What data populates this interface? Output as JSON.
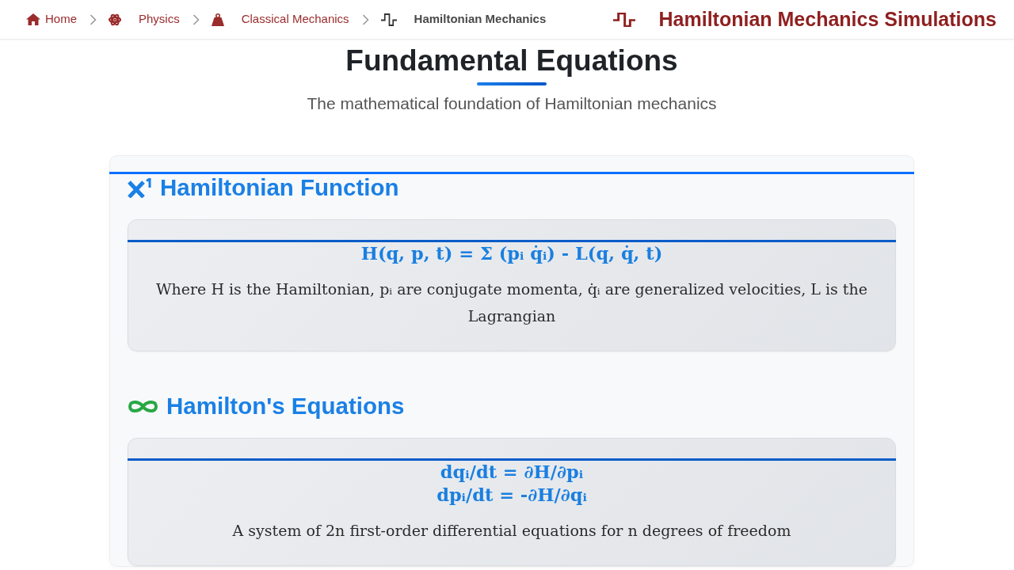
{
  "breadcrumb": [
    {
      "label": "Home",
      "current": false
    },
    {
      "label": "Physics",
      "current": false
    },
    {
      "label": "Classical Mechanics",
      "current": false
    },
    {
      "label": "Hamiltonian Mechanics",
      "current": true
    }
  ],
  "brand": {
    "title": "Hamiltonian Mechanics Simulations"
  },
  "header": {
    "title": "Fundamental Equations",
    "subtitle": "The mathematical foundation of Hamiltonian mechanics"
  },
  "sections": [
    {
      "title": "Hamiltonian Function",
      "equations": [
        "H(q, p, t) = Σ (pᵢ q̇ᵢ) - L(q, q̇, t)"
      ],
      "description": "Where H is the Hamiltonian, pᵢ are conjugate momenta, q̇ᵢ are generalized velocities, L is the Lagrangian"
    },
    {
      "title": "Hamilton's Equations",
      "equations": [
        "dqᵢ/dt = ∂H/∂pᵢ",
        "dpᵢ/dt = -∂H/∂qᵢ"
      ],
      "description": "A system of 2n first-order differential equations for n degrees of freedom"
    }
  ]
}
